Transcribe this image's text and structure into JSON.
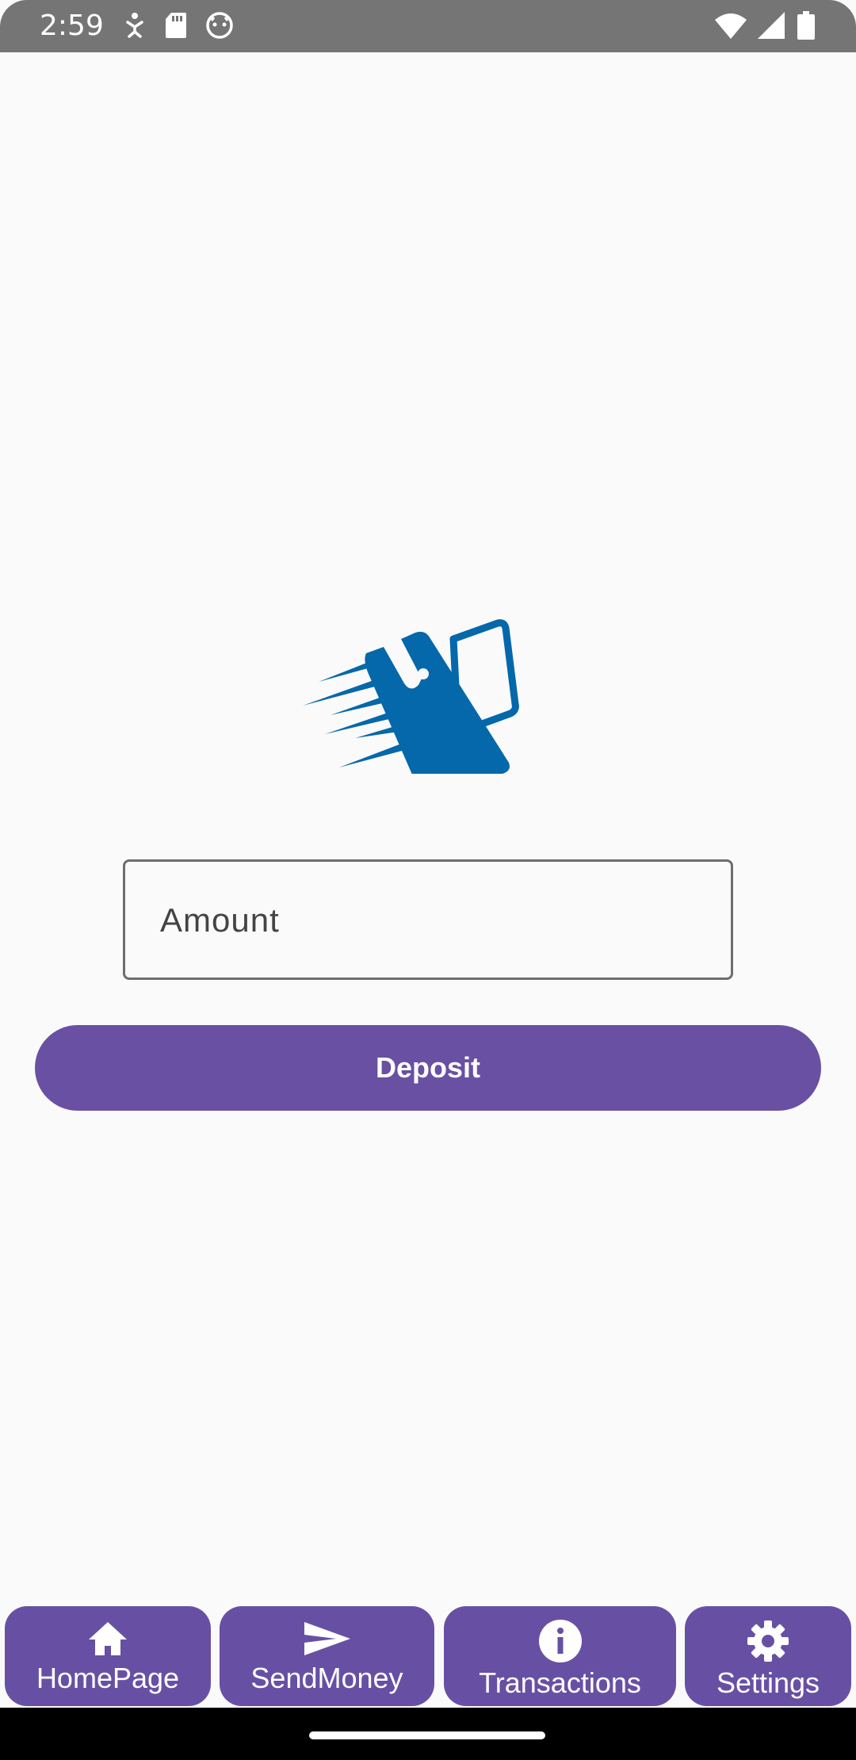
{
  "status_bar": {
    "time": "2:59",
    "left_icons": [
      "accessibility-icon",
      "sd-card-icon",
      "android-icon"
    ],
    "right_icons": [
      "wifi-icon",
      "signal-icon",
      "battery-icon"
    ]
  },
  "logo": {
    "icon": "wallet-icon",
    "color": "#0468AA"
  },
  "amount_field": {
    "label": "Amount",
    "value": ""
  },
  "deposit_button": {
    "label": "Deposit",
    "color": "#6950A3"
  },
  "bottom_nav": {
    "color": "#6750A4",
    "items": [
      {
        "label": "HomePage",
        "icon": "home-icon"
      },
      {
        "label": "SendMoney",
        "icon": "send-icon"
      },
      {
        "label": "Transactions",
        "icon": "info-icon"
      },
      {
        "label": "Settings",
        "icon": "gear-icon"
      }
    ]
  }
}
